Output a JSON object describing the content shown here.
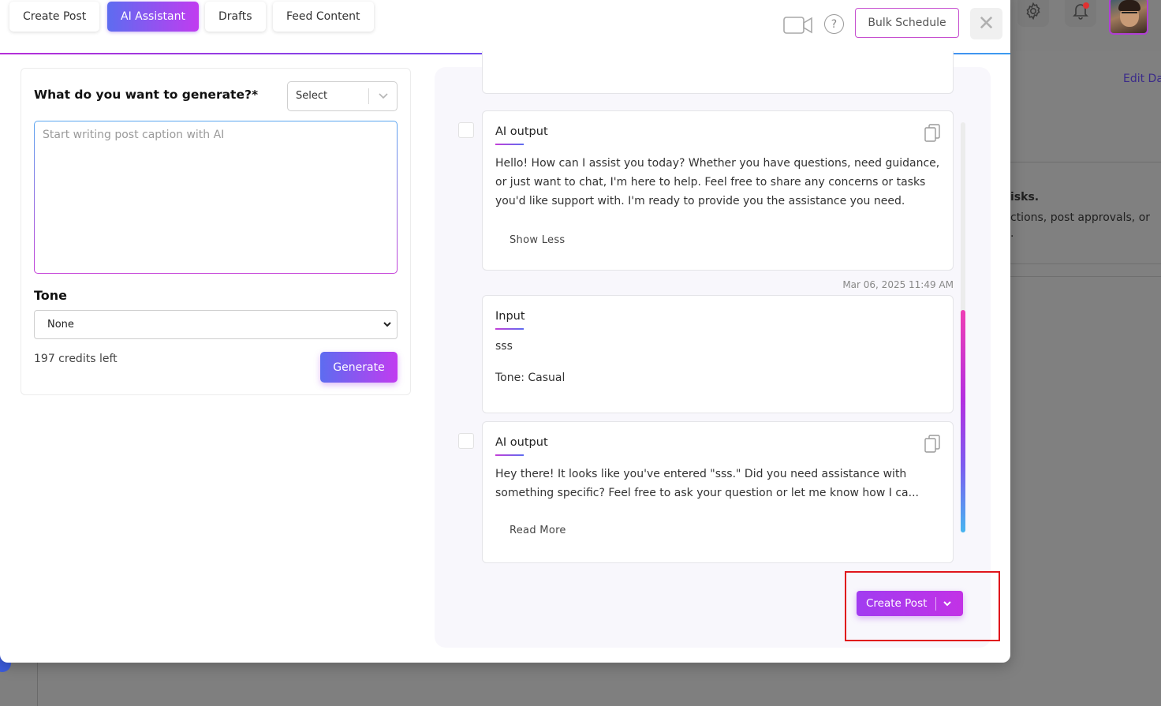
{
  "background": {
    "edit_link": "Edit Da",
    "card_title": "isks.",
    "card_text": "ctions, post approvals, or",
    "card_dot": "."
  },
  "header": {
    "tabs": [
      {
        "label": "Create Post",
        "active": false
      },
      {
        "label": "AI Assistant",
        "active": true
      },
      {
        "label": "Drafts",
        "active": false
      },
      {
        "label": "Feed Content",
        "active": false
      }
    ],
    "help_glyph": "?",
    "bulk_schedule_label": "Bulk Schedule",
    "close_glyph": "✕"
  },
  "form": {
    "title": "What do you want to generate?*",
    "type_select": {
      "value": "Select"
    },
    "caption_placeholder": "Start writing post caption with AI",
    "tone_label": "Tone",
    "tone_select": {
      "value": "None"
    },
    "credits": "197 credits left",
    "generate_label": "Generate"
  },
  "history": [
    {
      "kind": "ai_output",
      "heading": "AI output",
      "text": "Hello! How can I assist you today? Whether you have questions, need guidance, or just want to chat, I'm here to help. Feel free to share any concerns or tasks you'd like support with. I'm ready to provide you the assistance you need.",
      "toggle_label": "Show Less"
    },
    {
      "kind": "timestamp",
      "text": "Mar 06, 2025 11:49 AM"
    },
    {
      "kind": "input",
      "heading": "Input",
      "prompt": "sss",
      "tone": "Tone: Casual"
    },
    {
      "kind": "ai_output",
      "heading": "AI output",
      "text": "Hey there! It looks like you've entered \"sss.\" Did you need assistance with something specific? Feel free to ask your question or let me know how I ca...",
      "toggle_label": "Read More"
    }
  ],
  "actions": {
    "create_post_label": "Create Post"
  },
  "colors": {
    "accent_gradient_start": "#5d6cf0",
    "accent_gradient_end": "#c13cf0",
    "highlight": "#e0161c"
  }
}
